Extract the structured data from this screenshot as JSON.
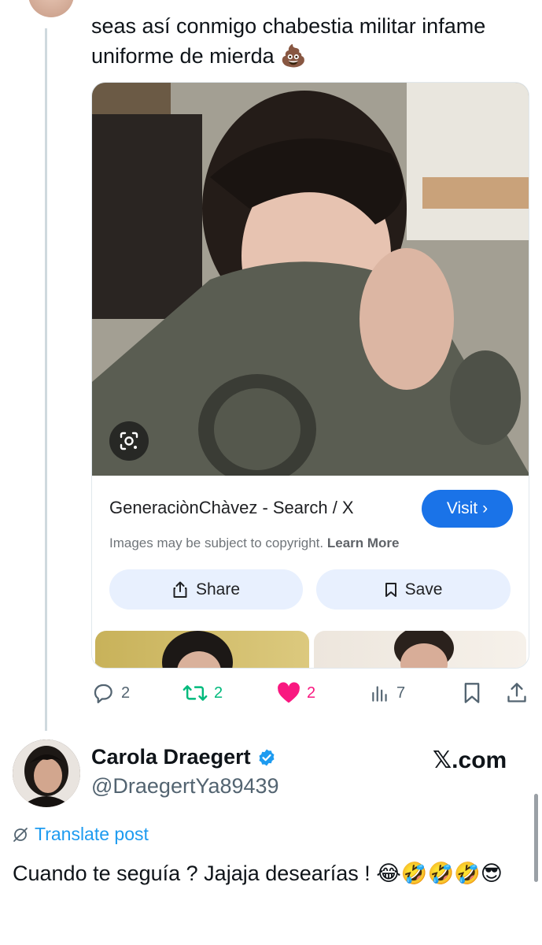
{
  "post": {
    "text": "seas así conmigo chabestia militar infame uniforme de mierda 💩"
  },
  "image_card": {
    "source_title": "GeneraciònChàvez - Search / X",
    "visit_label": "Visit",
    "visit_chevron": "›",
    "copyright_text": "Images may be subject to copyright.",
    "learn_more_label": "Learn More",
    "share_label": "Share",
    "save_label": "Save"
  },
  "engagement": {
    "replies": "2",
    "reposts": "2",
    "likes": "2",
    "views": "7"
  },
  "reply": {
    "display_name": "Carola Draegert",
    "handle": "@DraegertYa89439",
    "brand": "𝕏.com",
    "translate_label": "Translate post",
    "text": "Cuando te seguía ? Jajaja desearías ! 😂🤣🤣🤣😎"
  },
  "colors": {
    "accent": "#1d9bf0",
    "visit_button": "#1a73e8",
    "repost": "#00ba7c",
    "like": "#f91880",
    "verified": "#1d9bf0",
    "secondary_text": "#536471"
  }
}
